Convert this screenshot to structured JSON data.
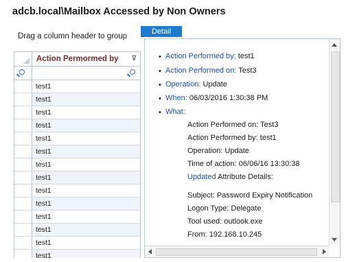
{
  "title": "adcb.local\\Mailbox Accessed by Non Owners",
  "group_hint": "Drag a column header to group",
  "detail_tab": "Detail",
  "grid": {
    "column_header": "Action Permormed by",
    "rows": [
      "test1",
      "test1",
      "test1",
      "test1",
      "test1",
      "test1",
      "test1",
      "test1",
      "test1",
      "test1",
      "test1",
      "test1",
      "test1",
      "test1"
    ]
  },
  "detail": {
    "items": [
      {
        "label": "Action Performed by:",
        "value": "test1"
      },
      {
        "label": "Action Performed on:",
        "value": "Test3"
      },
      {
        "label": "Operation:",
        "value": "Update"
      },
      {
        "label": "When:",
        "value": "06/03/2016 1:30:38 PM"
      },
      {
        "label": "What:",
        "value": ""
      }
    ],
    "what": {
      "action_on": "Action Performed on:  Test3",
      "action_by": "Action Performed by:  test1",
      "operation": "Operation:  Update",
      "time": "Time of action:  06/06/16 13:30:38",
      "updated_word": "Updated",
      "updated_rest": " Attribute Details:",
      "subject": "Subject:  Password Expiry Notification",
      "logon": "Logon Type:  Delegate",
      "tool": "Tool used:  outlook.exe",
      "from": "From:  192.168.10.245"
    }
  }
}
